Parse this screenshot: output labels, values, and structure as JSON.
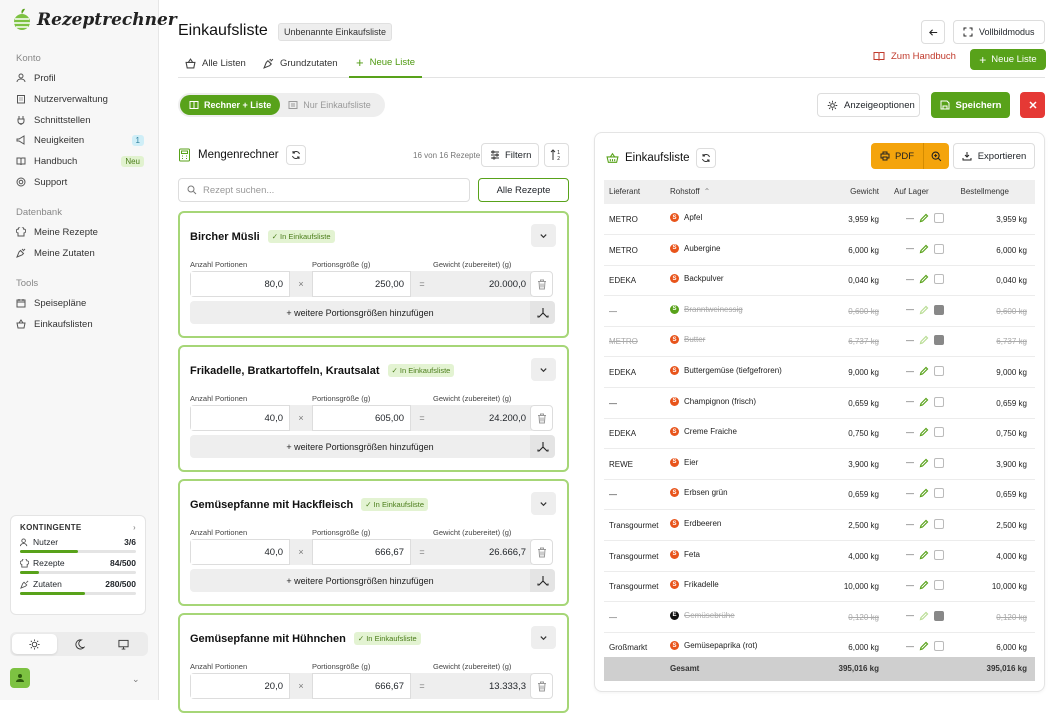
{
  "app": {
    "logo_text": "Rezeptrechner"
  },
  "sidebar": {
    "sections": [
      {
        "label": "Konto",
        "items": [
          {
            "label": "Profil"
          },
          {
            "label": "Nutzerverwaltung"
          },
          {
            "label": "Schnittstellen"
          },
          {
            "label": "Neuigkeiten",
            "badge": "1"
          },
          {
            "label": "Handbuch",
            "badge": "Neu"
          },
          {
            "label": "Support"
          }
        ]
      },
      {
        "label": "Datenbank",
        "items": [
          {
            "label": "Meine Rezepte"
          },
          {
            "label": "Meine Zutaten"
          }
        ]
      },
      {
        "label": "Tools",
        "items": [
          {
            "label": "Speisepläne"
          },
          {
            "label": "Einkaufslisten"
          }
        ]
      }
    ],
    "quota": {
      "title": "KONTINGENTE",
      "rows": [
        {
          "label": "Nutzer",
          "value": "3/6",
          "fill": 0.5
        },
        {
          "label": "Rezepte",
          "value": "84/500",
          "fill": 0.168
        },
        {
          "label": "Zutaten",
          "value": "280/500",
          "fill": 0.56
        }
      ]
    }
  },
  "header": {
    "title": "Einkaufsliste",
    "badge": "Unbenannte Einkaufsliste",
    "fullscreen_label": "Vollbildmodus"
  },
  "tabs": [
    {
      "label": "Alle Listen"
    },
    {
      "label": "Grundzutaten"
    },
    {
      "label": "Neue Liste"
    }
  ],
  "actions": {
    "handbook_label": "Zum Handbuch",
    "new_list_label": "Neue Liste",
    "options_label": "Anzeigeoptionen",
    "save_label": "Speichern"
  },
  "view_toggle": {
    "option_a": "Rechner + Liste",
    "option_b": "Nur Einkaufsliste"
  },
  "calculator": {
    "title": "Mengenrechner",
    "count": "16 von 16 Rezepte",
    "filter_label": "Filtern",
    "search_placeholder": "Rezept suchen...",
    "all_recipes_label": "Alle Rezepte",
    "field_labels": {
      "portions": "Anzahl Portionen",
      "size": "Portionsgröße (g)",
      "weight": "Gewicht (zubereitet) (g)"
    },
    "in_list_label": "✓ In Einkaufsliste",
    "more_label": "+ weitere Portionsgrößen hinzufügen",
    "recipes": [
      {
        "name": "Bircher Müsli",
        "portions": "80,0",
        "size": "250,00",
        "weight": "20.000,0"
      },
      {
        "name": "Frikadelle, Bratkartoffeln, Krautsalat",
        "portions": "40,0",
        "size": "605,00",
        "weight": "24.200,0"
      },
      {
        "name": "Gemüsepfanne mit Hackfleisch",
        "portions": "40,0",
        "size": "666,67",
        "weight": "26.666,7"
      },
      {
        "name": "Gemüsepfanne mit Hühnchen",
        "portions": "20,0",
        "size": "666,67",
        "weight": "13.333,3"
      }
    ]
  },
  "shopping": {
    "title": "Einkaufsliste",
    "pdf_label": "PDF",
    "export_label": "Exportieren",
    "columns": {
      "lieferant": "Lieferant",
      "rohstoff": "Rohstoff",
      "gewicht": "Gewicht",
      "lager": "Auf Lager",
      "bestell": "Bestellmenge"
    },
    "rows": [
      {
        "lieferant": "METRO",
        "rohstoff": "Apfel",
        "gewicht": "3,959 kg",
        "bestell": "3,959 kg",
        "checked": false,
        "dot": "#e8541b",
        "dot_letter": "S"
      },
      {
        "lieferant": "METRO",
        "rohstoff": "Aubergine",
        "gewicht": "6,000 kg",
        "bestell": "6,000 kg",
        "checked": false,
        "dot": "#e8541b",
        "dot_letter": "S"
      },
      {
        "lieferant": "EDEKA",
        "rohstoff": "Backpulver",
        "gewicht": "0,040 kg",
        "bestell": "0,040 kg",
        "checked": false,
        "dot": "#e8541b",
        "dot_letter": "S"
      },
      {
        "lieferant": "—",
        "rohstoff": "Branntweinessig",
        "gewicht": "0,600 kg",
        "bestell": "0,600 kg",
        "checked": true,
        "dot": "#58a21a",
        "dot_letter": "S"
      },
      {
        "lieferant": "METRO",
        "rohstoff": "Butter",
        "gewicht": "6,737 kg",
        "bestell": "6,737 kg",
        "checked": true,
        "dot": "#e8541b",
        "dot_letter": "S"
      },
      {
        "lieferant": "EDEKA",
        "rohstoff": "Buttergemüse (tiefgefroren)",
        "gewicht": "9,000 kg",
        "bestell": "9,000 kg",
        "checked": false,
        "dot": "#e8541b",
        "dot_letter": "S"
      },
      {
        "lieferant": "—",
        "rohstoff": "Champignon (frisch)",
        "gewicht": "0,659 kg",
        "bestell": "0,659 kg",
        "checked": false,
        "dot": "#e8541b",
        "dot_letter": "S"
      },
      {
        "lieferant": "EDEKA",
        "rohstoff": "Creme Fraiche",
        "gewicht": "0,750 kg",
        "bestell": "0,750 kg",
        "checked": false,
        "dot": "#e8541b",
        "dot_letter": "S"
      },
      {
        "lieferant": "REWE",
        "rohstoff": "Eier",
        "gewicht": "3,900 kg",
        "bestell": "3,900 kg",
        "checked": false,
        "dot": "#e8541b",
        "dot_letter": "S"
      },
      {
        "lieferant": "—",
        "rohstoff": "Erbsen grün",
        "gewicht": "0,659 kg",
        "bestell": "0,659 kg",
        "checked": false,
        "dot": "#e8541b",
        "dot_letter": "S"
      },
      {
        "lieferant": "Transgourmet",
        "rohstoff": "Erdbeeren",
        "gewicht": "2,500 kg",
        "bestell": "2,500 kg",
        "checked": false,
        "dot": "#e8541b",
        "dot_letter": "S"
      },
      {
        "lieferant": "Transgourmet",
        "rohstoff": "Feta",
        "gewicht": "4,000 kg",
        "bestell": "4,000 kg",
        "checked": false,
        "dot": "#e8541b",
        "dot_letter": "S"
      },
      {
        "lieferant": "Transgourmet",
        "rohstoff": "Frikadelle",
        "gewicht": "10,000 kg",
        "bestell": "10,000 kg",
        "checked": false,
        "dot": "#e8541b",
        "dot_letter": "S"
      },
      {
        "lieferant": "—",
        "rohstoff": "Gemüsebrühe",
        "gewicht": "0,120 kg",
        "bestell": "0,120 kg",
        "checked": true,
        "dot": "#111111",
        "dot_letter": "E"
      },
      {
        "lieferant": "Großmarkt",
        "rohstoff": "Gemüsepaprika (rot)",
        "gewicht": "6,000 kg",
        "bestell": "6,000 kg",
        "checked": false,
        "dot": "#e8541b",
        "dot_letter": "S"
      }
    ],
    "total": {
      "label": "Gesamt",
      "gewicht": "395,016 kg",
      "bestell": "395,016 kg"
    }
  }
}
